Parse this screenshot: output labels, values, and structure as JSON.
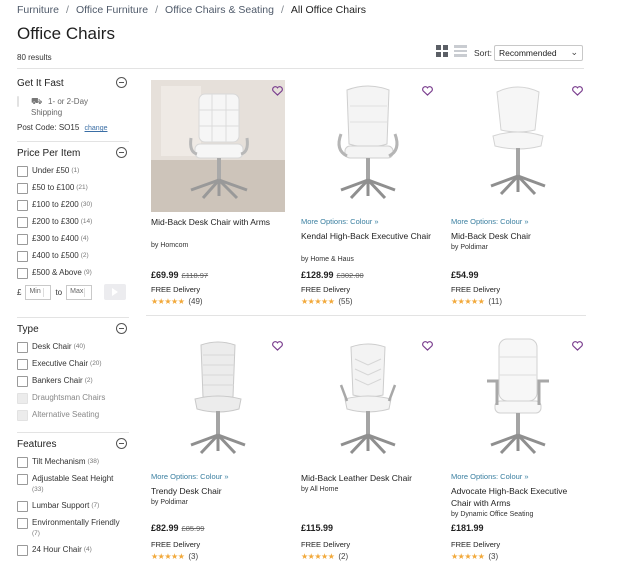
{
  "breadcrumb": {
    "items": [
      "Furniture",
      "Office Furniture",
      "Office Chairs & Seating"
    ],
    "separator": "/",
    "current": "All Office Chairs"
  },
  "page": {
    "title": "Office Chairs",
    "results": "80 results"
  },
  "toolbar": {
    "sort_label": "Sort:",
    "sort_value": "Recommended",
    "view_mode": "grid"
  },
  "filters": {
    "fast": {
      "title": "Get It Fast",
      "option_line1": "1- or 2-Day",
      "option_line2": "Shipping",
      "postcode_label": "Post Code:",
      "postcode_value": "SO15",
      "change_label": "change"
    },
    "price": {
      "title": "Price Per Item",
      "options": [
        {
          "label": "Under £50",
          "count": "(1)"
        },
        {
          "label": "£50 to £100",
          "count": "(21)"
        },
        {
          "label": "£100 to £200",
          "count": "(30)"
        },
        {
          "label": "£200 to £300",
          "count": "(14)"
        },
        {
          "label": "£300 to £400",
          "count": "(4)"
        },
        {
          "label": "£400 to £500",
          "count": "(2)"
        },
        {
          "label": "£500 & Above",
          "count": "(9)"
        }
      ],
      "currency": "£",
      "min_placeholder": "Min",
      "to_label": "to",
      "max_placeholder": "Max"
    },
    "type": {
      "title": "Type",
      "options": [
        {
          "label": "Desk Chair",
          "count": "(40)"
        },
        {
          "label": "Executive Chair",
          "count": "(20)"
        },
        {
          "label": "Bankers Chair",
          "count": "(2)"
        },
        {
          "label": "Draughtsman Chairs",
          "count": ""
        },
        {
          "label": "Alternative Seating",
          "count": ""
        }
      ]
    },
    "features": {
      "title": "Features",
      "options": [
        {
          "label": "Tilt Mechanism",
          "count": "(38)"
        },
        {
          "label": "Adjustable Seat Height",
          "count": "(33)"
        },
        {
          "label": "Lumbar Support",
          "count": "(7)"
        },
        {
          "label": "Environmentally Friendly",
          "count": "(7)"
        },
        {
          "label": "24 Hour Chair",
          "count": "(4)"
        }
      ]
    }
  },
  "products": [
    {
      "more_options": "",
      "name": "Mid-Back Desk Chair with Arms",
      "brand": "by Homcom",
      "price": "£69.99",
      "was": "£118.97",
      "delivery": "FREE Delivery",
      "stars": "★★★★★",
      "rating": 4.5,
      "reviews": "(49)",
      "image": "chair-with-armrests-photo"
    },
    {
      "more_options": "More Options: Colour »",
      "name": "Kendal High-Back Executive Chair",
      "brand": "by Home & Haus",
      "price": "£128.99",
      "was": "£302.00",
      "delivery": "FREE Delivery",
      "stars": "★★★★★",
      "rating": 4.5,
      "reviews": "(55)",
      "image": "executive-chair"
    },
    {
      "more_options": "More Options: Colour »",
      "name": "Mid-Back Desk Chair",
      "brand": "by Poldimar",
      "price": "£54.99",
      "was": "",
      "delivery": "FREE Delivery",
      "stars": "★★★★★",
      "rating": 4.5,
      "reviews": "(11)",
      "image": "armless-chair"
    },
    {
      "more_options": "More Options: Colour »",
      "name": "Trendy Desk Chair",
      "brand": "by Poldimar",
      "price": "£82.99",
      "was": "£85.99",
      "delivery": "FREE Delivery",
      "stars": "★★★★★",
      "rating": 4.5,
      "reviews": "(3)",
      "image": "ribbed-armless-chair"
    },
    {
      "more_options": "",
      "name": "Mid-Back Leather Desk Chair",
      "brand": "by All Home",
      "price": "£115.99",
      "was": "",
      "delivery": "FREE Delivery",
      "stars": "★★★★★",
      "rating": 5,
      "reviews": "(2)",
      "image": "chevron-chair"
    },
    {
      "more_options": "More Options: Colour »",
      "name": "Advocate High-Back Executive Chair with Arms",
      "brand": "by Dynamic Office Seating",
      "price": "£181.99",
      "was": "",
      "delivery": "FREE Delivery",
      "stars": "★★★★★",
      "rating": 4.5,
      "reviews": "(3)",
      "image": "high-back-executive-chair"
    }
  ],
  "colors": {
    "accent_link": "#3a7fa0",
    "star": "#f2a93b",
    "heart": "#7b3f8f"
  }
}
